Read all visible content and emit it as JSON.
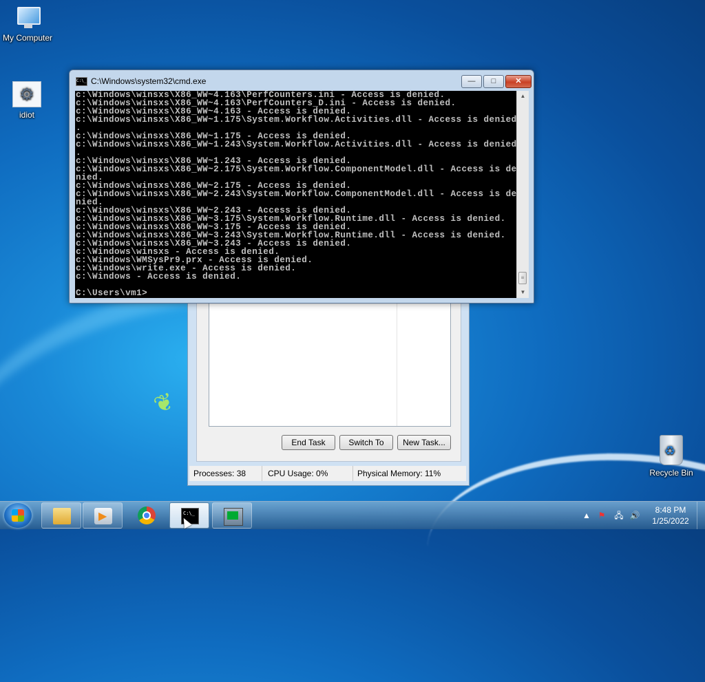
{
  "desktop": {
    "icons": [
      {
        "label": "My Computer",
        "icon": "computer-icon"
      },
      {
        "label": "idiot",
        "icon": "settings-gear-icon"
      },
      {
        "label": "Recycle Bin",
        "icon": "recycle-bin-icon"
      }
    ]
  },
  "cmd_window": {
    "title": "C:\\Windows\\system32\\cmd.exe",
    "icon_text": "C:\\_",
    "minimize": "—",
    "maximize": "□",
    "close": "✕",
    "console_text": "c:\\Windows\\winsxs\\X86_WW~4.163\\PerfCounters.ini - Access is denied.\nc:\\Windows\\winsxs\\X86_WW~4.163\\PerfCounters_D.ini - Access is denied.\nc:\\Windows\\winsxs\\X86_WW~4.163 - Access is denied.\nc:\\Windows\\winsxs\\X86_WW~1.175\\System.Workflow.Activities.dll - Access is denied\n.\nc:\\Windows\\winsxs\\X86_WW~1.175 - Access is denied.\nc:\\Windows\\winsxs\\X86_WW~1.243\\System.Workflow.Activities.dll - Access is denied\n.\nc:\\Windows\\winsxs\\X86_WW~1.243 - Access is denied.\nc:\\Windows\\winsxs\\X86_WW~2.175\\System.Workflow.ComponentModel.dll - Access is de\nnied.\nc:\\Windows\\winsxs\\X86_WW~2.175 - Access is denied.\nc:\\Windows\\winsxs\\X86_WW~2.243\\System.Workflow.ComponentModel.dll - Access is de\nnied.\nc:\\Windows\\winsxs\\X86_WW~2.243 - Access is denied.\nc:\\Windows\\winsxs\\X86_WW~3.175\\System.Workflow.Runtime.dll - Access is denied.\nc:\\Windows\\winsxs\\X86_WW~3.175 - Access is denied.\nc:\\Windows\\winsxs\\X86_WW~3.243\\System.Workflow.Runtime.dll - Access is denied.\nc:\\Windows\\winsxs\\X86_WW~3.243 - Access is denied.\nc:\\Windows\\winsxs - Access is denied.\nc:\\Windows\\WMSysPr9.prx - Access is denied.\nc:\\Windows\\write.exe - Access is denied.\nc:\\Windows - Access is denied.\n\nC:\\Users\\vm1>"
  },
  "task_manager": {
    "buttons": {
      "end_task": "End Task",
      "switch_to": "Switch To",
      "new_task": "New Task..."
    },
    "status": {
      "processes": "Processes: 38",
      "cpu": "CPU Usage: 0%",
      "memory": "Physical Memory: 11%"
    }
  },
  "taskbar": {
    "items": [
      {
        "name": "Windows Explorer",
        "icon": "folder-icon"
      },
      {
        "name": "Windows Media Player",
        "icon": "media-player-icon"
      },
      {
        "name": "Google Chrome",
        "icon": "chrome-icon"
      },
      {
        "name": "cmd.exe",
        "icon": "cmd-icon",
        "active": true
      },
      {
        "name": "Task Manager",
        "icon": "task-manager-icon"
      }
    ],
    "tray": {
      "show_hidden": "▲",
      "time": "8:48 PM",
      "date": "1/25/2022"
    }
  }
}
